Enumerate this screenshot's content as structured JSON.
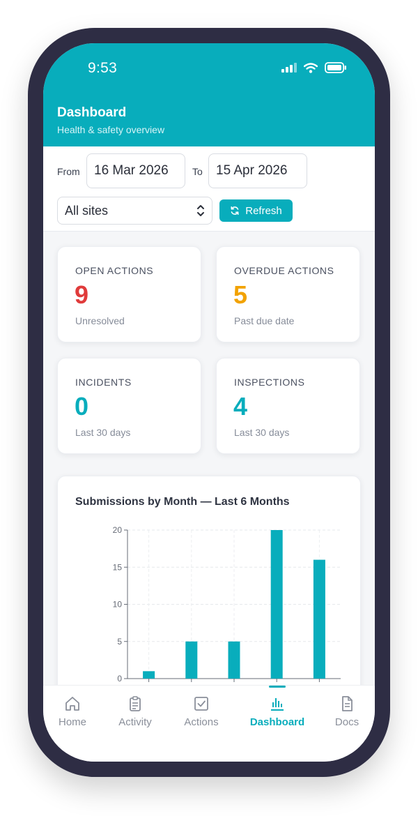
{
  "status_bar": {
    "time": "9:53"
  },
  "header": {
    "title": "Dashboard",
    "subtitle": "Health & safety overview"
  },
  "filters": {
    "from_label": "From",
    "from_date": "16 Mar 2026",
    "to_label": "To",
    "to_date": "15 Apr 2026",
    "site_select": "All sites",
    "refresh_label": "Refresh"
  },
  "stats": [
    {
      "label": "OPEN ACTIONS",
      "value": "9",
      "sub": "Unresolved",
      "color": "#e03b3b"
    },
    {
      "label": "OVERDUE ACTIONS",
      "value": "5",
      "sub": "Past due date",
      "color": "#f2a200"
    },
    {
      "label": "INCIDENTS",
      "value": "0",
      "sub": "Last 30 days",
      "color": "#08adbc"
    },
    {
      "label": "INSPECTIONS",
      "value": "4",
      "sub": "Last 30 days",
      "color": "#08adbc"
    }
  ],
  "chart_data": {
    "type": "bar",
    "title": "Submissions by Month — Last 6 Months",
    "categories": [
      "",
      "",
      "",
      "",
      ""
    ],
    "values": [
      1,
      5,
      5,
      20,
      16
    ],
    "ylim": [
      0,
      20
    ],
    "yticks": [
      "0",
      "5",
      "10",
      "15",
      "20"
    ],
    "grid": true,
    "bar_color": "#08adbc"
  },
  "tabbar": {
    "items": [
      {
        "label": "Home",
        "icon": "home-icon"
      },
      {
        "label": "Activity",
        "icon": "clipboard-icon"
      },
      {
        "label": "Actions",
        "icon": "checkbox-icon"
      },
      {
        "label": "Dashboard",
        "icon": "bar-chart-icon",
        "active": true
      },
      {
        "label": "Docs",
        "icon": "document-icon"
      }
    ]
  }
}
